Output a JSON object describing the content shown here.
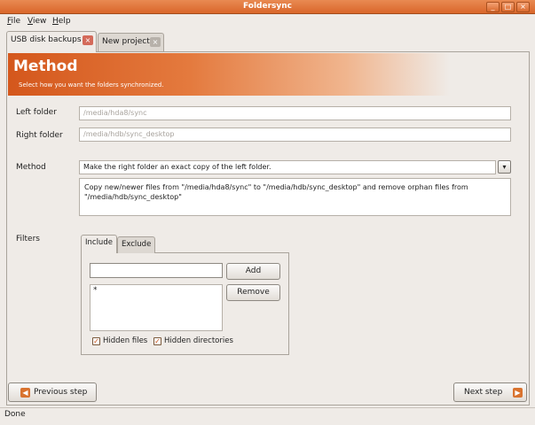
{
  "window": {
    "title": "Foldersync"
  },
  "menubar": {
    "items": [
      "File",
      "View",
      "Help"
    ]
  },
  "tabs": [
    {
      "label": "USB disk backups",
      "active": true
    },
    {
      "label": "New project",
      "active": false
    }
  ],
  "header": {
    "title": "Method",
    "subtitle": "Select how you want the folders synchronized."
  },
  "folders": {
    "left_label": "Left folder",
    "left_placeholder": "/media/hda8/sync",
    "right_label": "Right folder",
    "right_placeholder": "/media/hdb/sync_desktop"
  },
  "method": {
    "label": "Method",
    "selected": "Make the right folder an exact copy of the left folder.",
    "description": "Copy new/newer files from \"/media/hda8/sync\" to \"/media/hdb/sync_desktop\" and remove orphan files from \"/media/hdb/sync_desktop\""
  },
  "filters": {
    "label": "Filters",
    "tabs": [
      "Include",
      "Exclude"
    ],
    "active_tab": "Include",
    "input_value": "",
    "add_label": "Add",
    "remove_label": "Remove",
    "patterns": [
      "*"
    ],
    "hidden_files_label": "Hidden files",
    "hidden_files_checked": true,
    "hidden_dirs_label": "Hidden directories",
    "hidden_dirs_checked": true
  },
  "navigation": {
    "previous_label": "Previous step",
    "next_label": "Next step"
  },
  "status": {
    "text": "Done"
  },
  "colors": {
    "accent": "#d9662a",
    "header_start": "#d4571c",
    "close_badge": "#d46a5a"
  }
}
